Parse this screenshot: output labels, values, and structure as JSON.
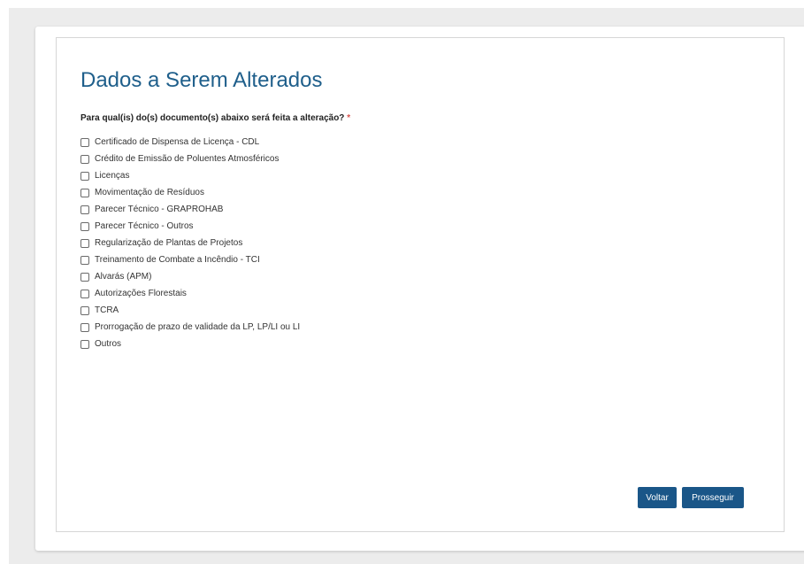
{
  "page": {
    "title": "Dados a Serem Alterados"
  },
  "form": {
    "question": "Para qual(is) do(s) documento(s) abaixo será feita a alteração?",
    "required_marker": "*",
    "options": [
      {
        "label": "Certificado de Dispensa de Licença - CDL",
        "checked": false
      },
      {
        "label": "Crédito de Emissão de Poluentes Atmosféricos",
        "checked": false
      },
      {
        "label": "Licenças",
        "checked": false
      },
      {
        "label": "Movimentação de Resíduos",
        "checked": false
      },
      {
        "label": "Parecer Técnico - GRAPROHAB",
        "checked": false
      },
      {
        "label": "Parecer Técnico - Outros",
        "checked": false
      },
      {
        "label": "Regularização de Plantas de Projetos",
        "checked": false
      },
      {
        "label": "Treinamento de Combate a Incêndio - TCI",
        "checked": false
      },
      {
        "label": "Alvarás (APM)",
        "checked": false
      },
      {
        "label": "Autorizações Florestais",
        "checked": false
      },
      {
        "label": "TCRA",
        "checked": false
      },
      {
        "label": "Prorrogação de prazo de validade da LP, LP/LI ou LI",
        "checked": false
      },
      {
        "label": "Outros",
        "checked": false
      }
    ]
  },
  "actions": {
    "back_label": "Voltar",
    "next_label": "Prosseguir"
  },
  "colors": {
    "title": "#1f5f8b",
    "button": "#1a5688",
    "required": "#d9534f",
    "page_background": "#ececec"
  }
}
